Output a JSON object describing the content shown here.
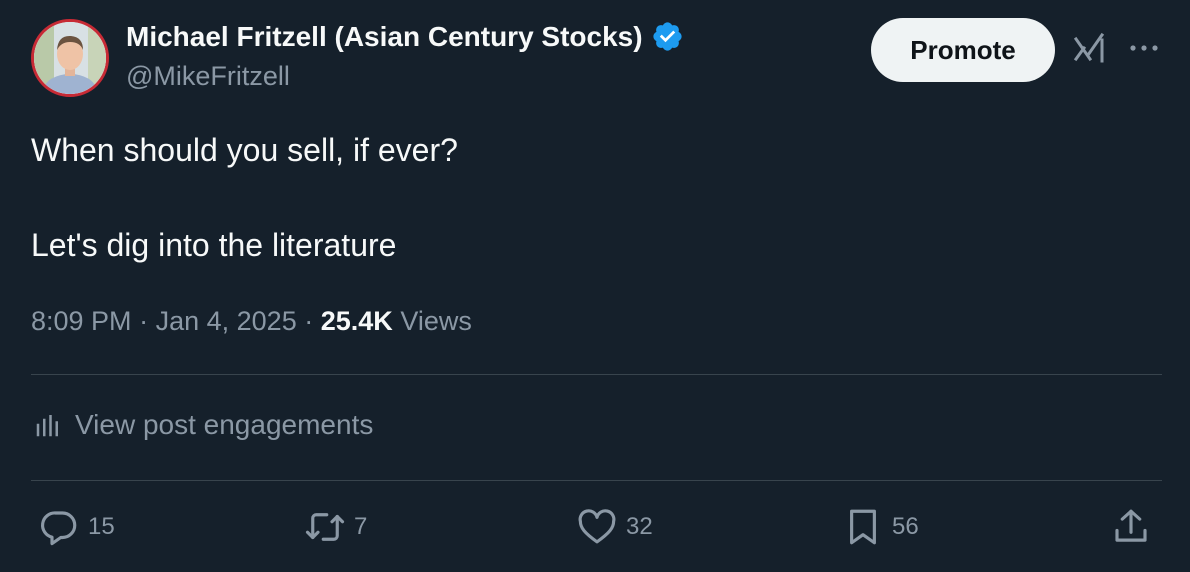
{
  "author": {
    "display_name": "Michael Fritzell (Asian Century Stocks)",
    "handle": "@MikeFritzell",
    "verified": true,
    "verified_color": "#1d9bf0"
  },
  "actions_top": {
    "promote_label": "Promote",
    "grok_icon": "grok-icon",
    "more_icon": "more-icon"
  },
  "post": {
    "line1": "When should you sell, if ever?",
    "line2": "Let's dig into the literature"
  },
  "meta": {
    "time": "8:09 PM",
    "separator": "·",
    "date": "Jan 4, 2025",
    "views_count": "25.4K",
    "views_label": "Views"
  },
  "engagements": {
    "label": "View post engagements",
    "icon": "bar-chart-icon"
  },
  "stats": {
    "replies": "15",
    "reposts": "7",
    "likes": "32",
    "bookmarks": "56"
  },
  "colors": {
    "background": "#15202b",
    "text_primary": "#f7f9f9",
    "text_secondary": "#8b98a5",
    "divider": "#38444d",
    "avatar_ring": "#c72a35"
  }
}
